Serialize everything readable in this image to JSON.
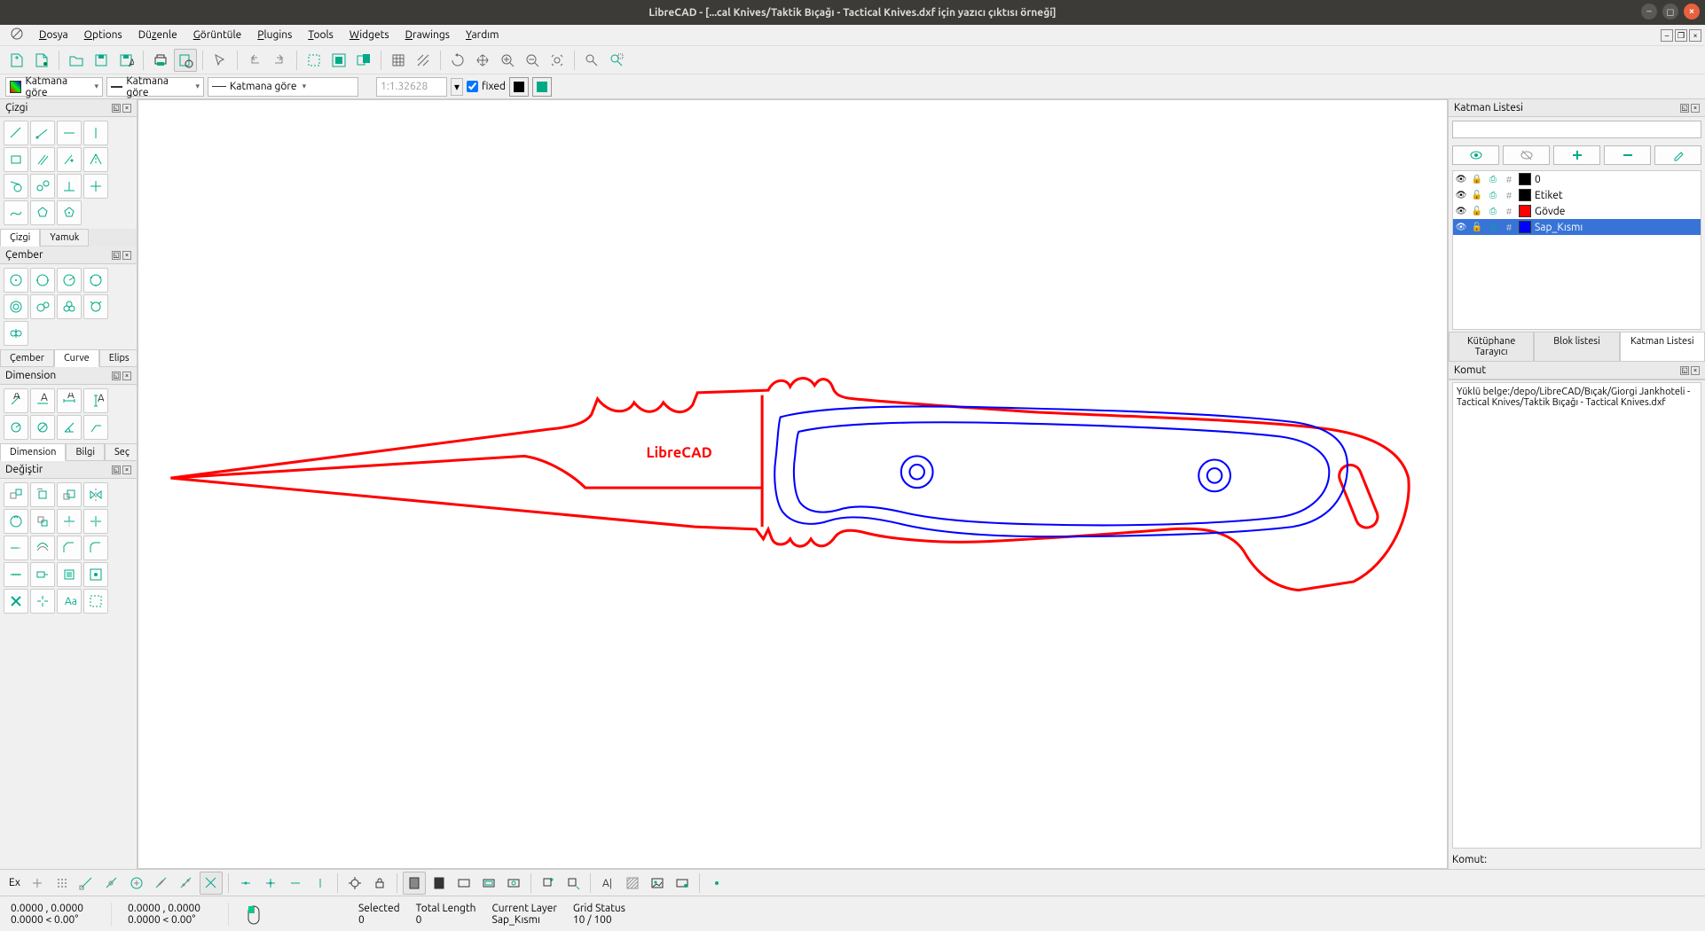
{
  "window": {
    "title": "LibreCAD - [...cal Knives/Taktik Bıçağı - Tactical Knives.dxf için yazıcı çıktısı örneği]"
  },
  "menu": {
    "app_icon": "librecad-icon",
    "items": [
      "Dosya",
      "Options",
      "Düzenle",
      "Görüntüle",
      "Plugins",
      "Tools",
      "Widgets",
      "Drawings",
      "Yardım"
    ]
  },
  "propbar": {
    "color_label": "Katmana göre",
    "width_label": "Katmana göre",
    "linetype_label": "Katmana göre",
    "scale_value": "1:1.32628",
    "fixed_label": "fixed",
    "fg_color": "#000000",
    "bg_color": "#00a000"
  },
  "left_docks": {
    "cizgi_title": "Çizgi",
    "cizgi_tabs": [
      "Çizgi",
      "Yamuk"
    ],
    "cember_title": "Çember",
    "cember_tabs": [
      "Çember",
      "Curve",
      "Elips"
    ],
    "dimension_title": "Dimension",
    "dim_tabs": [
      "Dimension",
      "Bilgi",
      "Seç"
    ],
    "degistir_title": "Değiştir"
  },
  "canvas": {
    "watermark": "LibreCAD"
  },
  "right": {
    "layer_title": "Katman Listesi",
    "filter_placeholder": "",
    "layers": [
      {
        "name": "0",
        "color": "#000000",
        "selected": false
      },
      {
        "name": "Etiket",
        "color": "#000000",
        "selected": false
      },
      {
        "name": "Gövde",
        "color": "#ff0000",
        "selected": false
      },
      {
        "name": "Sap_Kısmı",
        "color": "#0000ff",
        "selected": true
      }
    ],
    "tabs": [
      "Kütüphane Tarayıcı",
      "Blok listesi",
      "Katman Listesi"
    ],
    "active_tab": 2,
    "komut_title": "Komut",
    "komut_output": "Yüklü belge:/depo/LibreCAD/Bıçak/Giorgi Jankhoteli - Tactical Knives/Taktik Bıçağı - Tactical Knives.dxf",
    "komut_label": "Komut:"
  },
  "bottom": {
    "ex_label": "Ex"
  },
  "status": {
    "coord1a": "0.0000 , 0.0000",
    "coord1b": "0.0000 < 0.00°",
    "coord2a": "0.0000 , 0.0000",
    "coord2b": "0.0000 < 0.00°",
    "sel_label": "Selected",
    "sel_val": "0",
    "len_label": "Total Length",
    "len_val": "0",
    "layer_label": "Current Layer",
    "layer_val": "Sap_Kısmı",
    "grid_label": "Grid Status",
    "grid_val": "10 / 100"
  }
}
